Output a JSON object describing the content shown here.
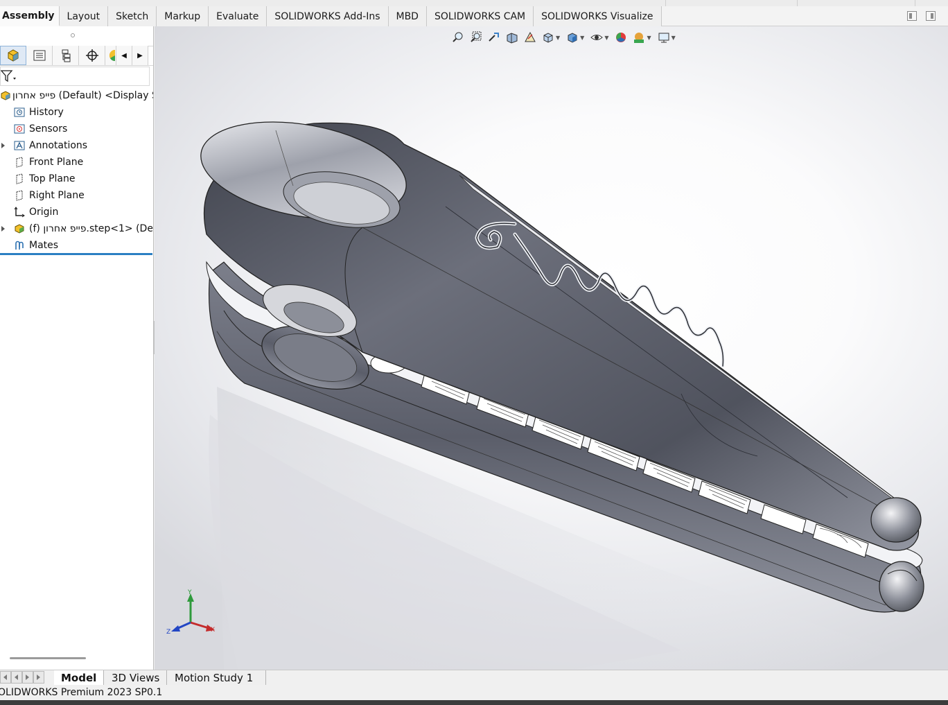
{
  "command_tabs": [
    "Assembly",
    "Layout",
    "Sketch",
    "Markup",
    "Evaluate",
    "SOLIDWORKS Add-Ins",
    "MBD",
    "SOLIDWORKS CAM",
    "SOLIDWORKS Visualize"
  ],
  "feature_tree": {
    "root_label": "פייפ אחרון (Default) <Display S",
    "items": [
      {
        "label": "History",
        "icon": "history-icon"
      },
      {
        "label": "Sensors",
        "icon": "sensor-icon"
      },
      {
        "label": "Annotations",
        "icon": "annotations-icon"
      },
      {
        "label": "Front Plane",
        "icon": "plane-icon"
      },
      {
        "label": "Top Plane",
        "icon": "plane-icon"
      },
      {
        "label": "Right Plane",
        "icon": "plane-icon"
      },
      {
        "label": "Origin",
        "icon": "origin-icon"
      },
      {
        "label": "(f) פייפ אחרון.step<1> (Def",
        "icon": "part-icon"
      },
      {
        "label": "Mates",
        "icon": "mates-icon"
      }
    ]
  },
  "triad": {
    "x": "X",
    "y": "Y",
    "z": "Z"
  },
  "bottom_tabs": [
    "Model",
    "3D Views",
    "Motion Study 1"
  ],
  "status_text": "OLIDWORKS Premium 2023 SP0.1",
  "colors": {
    "accent": "#2b7fc3",
    "model_dark": "#5a5d68",
    "model_light": "#eeeff3"
  }
}
